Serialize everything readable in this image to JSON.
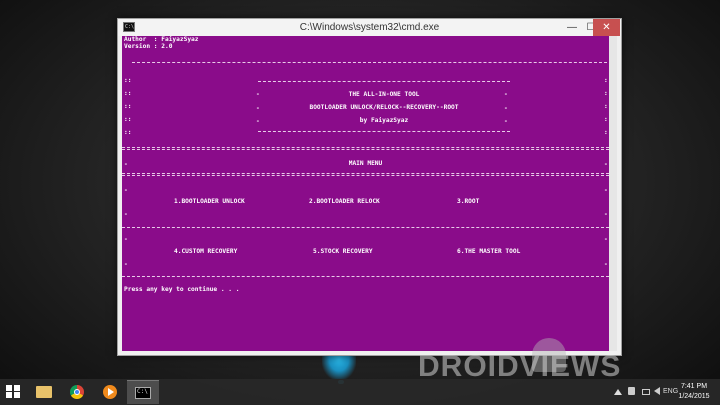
{
  "window": {
    "title": "C:\\Windows\\system32\\cmd.exe",
    "icon_text": "C:\\",
    "minimize": "—",
    "maximize": "☐",
    "close": "✕"
  },
  "console": {
    "author": "Author  : FaiyazSyaz",
    "version": "Version : 2.0",
    "side_marker": "::",
    "header_line1": "THE ALL-IN-ONE TOOL",
    "header_line2": "BOOTLOADER UNLOCK/RELOCK--RECOVERY--ROOT",
    "header_line3": "by FaiyazSyaz",
    "dash_marker": "-",
    "menu_title": "MAIN MENU",
    "option1": "1.BOOTLOADER UNLOCK",
    "option2": "2.BOOTLOADER RELOCK",
    "option3": "3.ROOT",
    "option4": "4.CUSTOM RECOVERY",
    "option5": "5.STOCK RECOVERY",
    "option6": "6.THE MASTER TOOL",
    "prompt": "Press any key to continue . . ."
  },
  "taskbar": {
    "lang": "ENG",
    "time": "7:41 PM",
    "date": "1/24/2015"
  },
  "watermark": "DROIDVIEWS",
  "colors": {
    "console_bg": "#8a0c8a",
    "close_button": "#c75050",
    "taskbar": "#282828"
  }
}
